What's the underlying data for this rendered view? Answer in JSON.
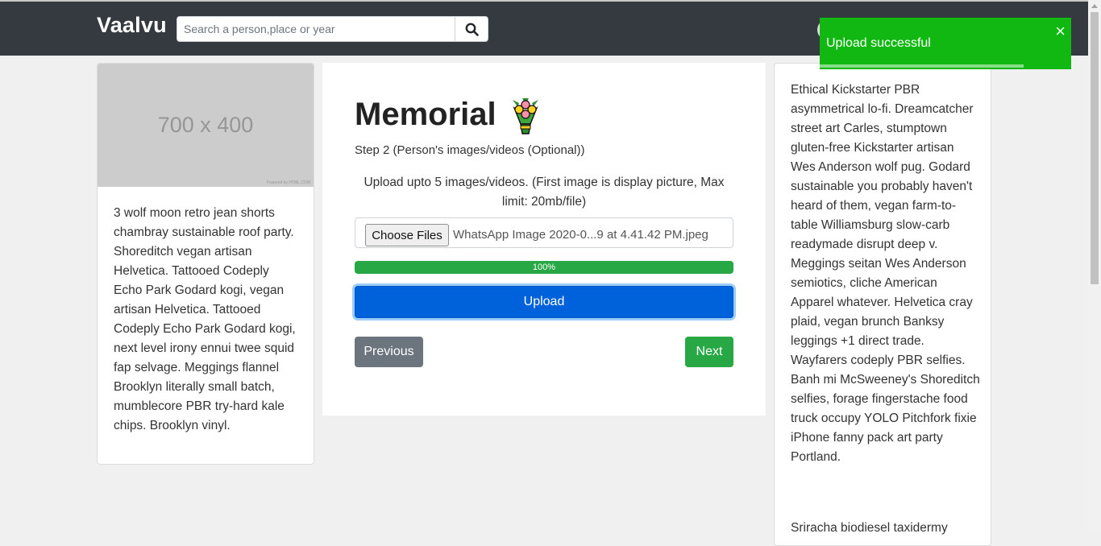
{
  "navbar": {
    "brand": "Vaalvu",
    "search_placeholder": "Search a person,place or year"
  },
  "left_card": {
    "image_text": "700 x 400",
    "image_tiny": "Powered by HTML.COM",
    "body": "3 wolf moon retro jean shorts chambray sustainable roof party. Shoreditch vegan artisan Helvetica. Tattooed Codeply Echo Park Godard kogi, vegan artisan Helvetica. Tattooed Codeply Echo Park Godard kogi, next level irony ennui twee squid fap selvage. Meggings flannel Brooklyn literally small batch, mumblecore PBR try-hard kale chips. Brooklyn vinyl."
  },
  "main": {
    "title": "Memorial",
    "step": "Step 2 (Person's images/videos (Optional))",
    "upload_hint": "Upload upto 5 images/videos. (First image is display picture, Max limit: 20mb/file)",
    "choose_files": "Choose Files",
    "file_name": "WhatsApp Image 2020-0...9 at 4.41.42 PM.jpeg",
    "progress_label": "100%",
    "progress_value": 100,
    "upload": "Upload",
    "previous": "Previous",
    "next": "Next"
  },
  "right_card": {
    "body": "Ethical Kickstarter PBR asymmetrical lo-fi. Dreamcatcher street art Carles, stumptown gluten-free Kickstarter artisan Wes Anderson wolf pug. Godard sustainable you probably haven't heard of them, vegan farm-to-table Williamsburg slow-carb readymade disrupt deep v. Meggings seitan Wes Anderson semiotics, cliche American Apparel whatever. Helvetica cray plaid, vegan brunch Banksy leggings +1 direct trade. Wayfarers codeply PBR selfies. Banh mi McSweeney's Shoreditch selfies, forage fingerstache food truck occupy YOLO Pitchfork fixie iPhone fanny pack art party Portland.",
    "body2": "Sriracha biodiesel taxidermy"
  },
  "toast": {
    "message": "Upload successful",
    "close": "×",
    "timer_remaining": 0.81
  },
  "colors": {
    "navbar": "#343a40",
    "toast": "#12b812",
    "primary": "#0062da",
    "success": "#28a745",
    "secondary": "#6c757d"
  },
  "icons": {
    "search": "search-icon",
    "title": "bouquet-icon",
    "close": "close-icon"
  }
}
